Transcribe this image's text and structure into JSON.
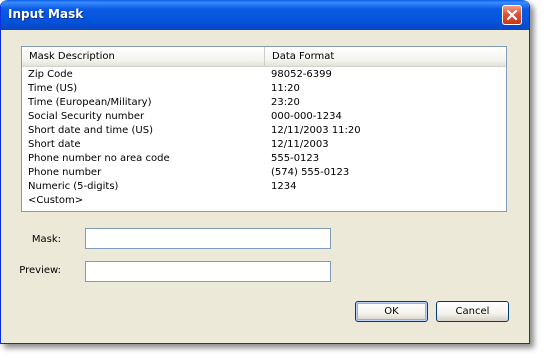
{
  "window": {
    "title": "Input Mask"
  },
  "list": {
    "columns": [
      "Mask Description",
      "Data Format"
    ],
    "rows": [
      [
        "Zip Code",
        "98052-6399"
      ],
      [
        "Time (US)",
        "11:20"
      ],
      [
        "Time (European/Military)",
        "23:20"
      ],
      [
        "Social Security number",
        "000-000-1234"
      ],
      [
        "Short date and time (US)",
        "12/11/2003 11:20"
      ],
      [
        "Short date",
        "12/11/2003"
      ],
      [
        "Phone number no area code",
        "555-0123"
      ],
      [
        "Phone number",
        "(574) 555-0123"
      ],
      [
        "Numeric (5-digits)",
        "1234"
      ],
      [
        "<Custom>",
        ""
      ]
    ]
  },
  "fields": {
    "mask_label": "Mask:",
    "mask_value": "",
    "preview_label": "Preview:",
    "preview_value": ""
  },
  "buttons": {
    "ok": "OK",
    "cancel": "Cancel"
  },
  "colors": {
    "titlebar": "#0a5ae4",
    "dialog_bg": "#ece9d8",
    "close_button": "#e0523a"
  },
  "icons": {
    "close": "close-icon"
  }
}
